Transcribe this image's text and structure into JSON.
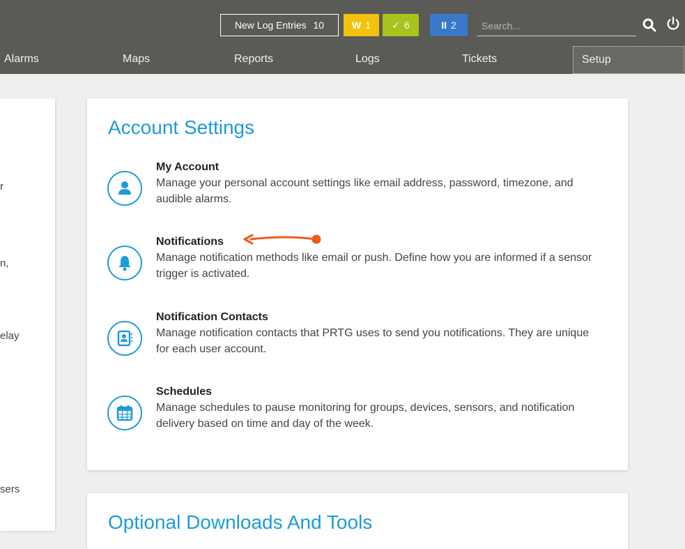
{
  "topbar": {
    "new_log_label": "New Log Entries",
    "new_log_count": "10",
    "warning_badge": {
      "label": "W",
      "count": "1"
    },
    "ok_badge": {
      "label": "✓",
      "count": "6"
    },
    "paused_badge": {
      "label": "II",
      "count": "2"
    },
    "search_placeholder": "Search...",
    "colors": {
      "bar": "#5a5a56",
      "warning": "#f2c20f",
      "ok": "#a9c31d",
      "paused": "#3a79c9"
    }
  },
  "nav": {
    "items": [
      "Alarms",
      "Maps",
      "Reports",
      "Logs",
      "Tickets",
      "Setup"
    ],
    "active": "Setup"
  },
  "left_panel": {
    "fragments": [
      "r",
      "n,",
      "elay",
      "sers"
    ]
  },
  "account_settings": {
    "title": "Account Settings",
    "items": [
      {
        "title": "My Account",
        "description": "Manage your personal account settings like email address, password, timezone, and audible alarms.",
        "icon": "user-icon"
      },
      {
        "title": "Notifications",
        "description": "Manage notification methods like email or push. Define how you are informed if a sensor trigger is activated.",
        "icon": "bell-icon"
      },
      {
        "title": "Notification Contacts",
        "description": "Manage notification contacts that PRTG uses to send you notifications. They are unique for each user account.",
        "icon": "contact-book-icon"
      },
      {
        "title": "Schedules",
        "description": "Manage schedules to pause monitoring for groups, devices, sensors, and notification delivery based on time and day of the week.",
        "icon": "calendar-icon"
      }
    ],
    "accent_color": "#1f9ad8",
    "annotation_color": "#f05a1a"
  },
  "optional_downloads": {
    "title": "Optional Downloads And Tools"
  }
}
